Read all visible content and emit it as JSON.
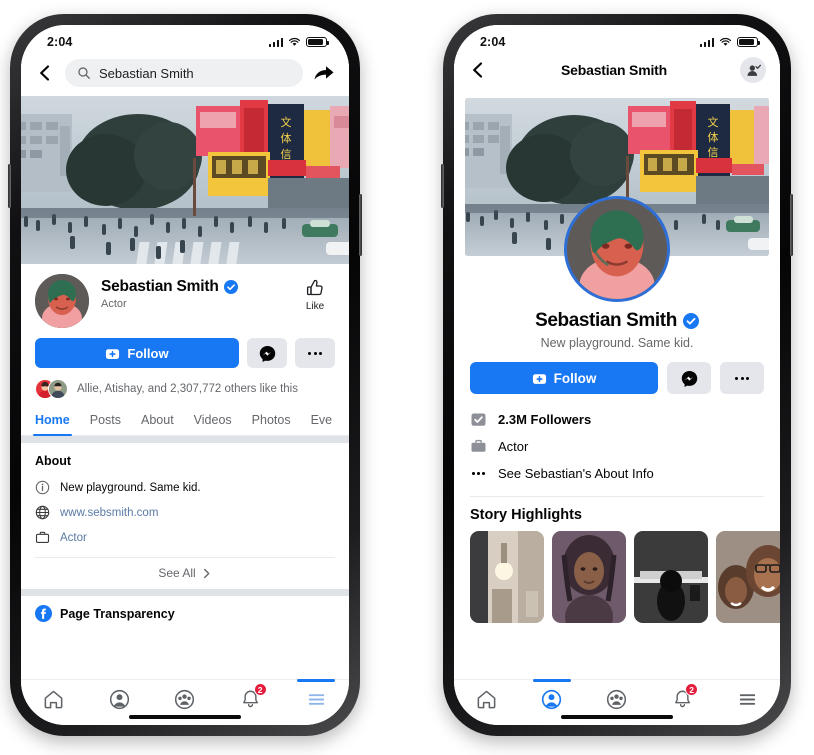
{
  "status_bar": {
    "time": "2:04",
    "signal_icon": "cellular-bars-icon",
    "wifi_icon": "wifi-icon",
    "battery_icon": "battery-icon"
  },
  "colors": {
    "brand_blue": "#1877f2",
    "verified_blue": "#1877f2",
    "badge_red": "#e41e3f",
    "chip_gray": "#e4e6eb",
    "text_secondary": "#65676b"
  },
  "left_phone": {
    "header": {
      "back_icon": "chevron-left-icon",
      "search_icon": "search-icon",
      "search_value": "Sebastian Smith",
      "search_placeholder": "Search",
      "share_icon": "share-arrow-icon"
    },
    "cover_photo_alt": "Shibuya crossing city street cover photo",
    "profile": {
      "avatar_alt": "Sebastian Smith profile photo",
      "name": "Sebastian Smith",
      "verified_icon": "verified-badge-icon",
      "category": "Actor",
      "like_icon": "thumbs-up-outline-icon",
      "like_label": "Like"
    },
    "actions": {
      "follow_label": "Follow",
      "follow_icon": "follow-plus-icon",
      "message_icon": "messenger-icon",
      "more_icon": "more-dots-icon"
    },
    "social_proof": "Allie, Atishay, and 2,307,772 others like this",
    "tabs": [
      {
        "label": "Home",
        "active": true
      },
      {
        "label": "Posts",
        "active": false
      },
      {
        "label": "About",
        "active": false
      },
      {
        "label": "Videos",
        "active": false
      },
      {
        "label": "Photos",
        "active": false
      },
      {
        "label": "Eve",
        "active": false
      }
    ],
    "about_card": {
      "title": "About",
      "rows": [
        {
          "icon": "info-circle-icon",
          "text": "New playground. Same kid.",
          "style": "plain"
        },
        {
          "icon": "globe-icon",
          "text": "www.sebsmith.com",
          "style": "link"
        },
        {
          "icon": "briefcase-icon",
          "text": "Actor",
          "style": "link"
        }
      ],
      "see_all_label": "See All",
      "see_all_icon": "chevron-right-icon"
    },
    "page_transparency": {
      "icon": "facebook-logo-icon",
      "label": "Page Transparency"
    },
    "bottom_nav": [
      {
        "icon": "home-icon",
        "active": false,
        "badge": ""
      },
      {
        "icon": "profile-circle-icon",
        "active": false,
        "badge": ""
      },
      {
        "icon": "groups-icon",
        "active": false,
        "badge": ""
      },
      {
        "icon": "notifications-bell-icon",
        "active": false,
        "badge": "2"
      },
      {
        "icon": "hamburger-menu-icon",
        "active": true,
        "badge": ""
      }
    ]
  },
  "right_phone": {
    "header": {
      "back_icon": "chevron-left-icon",
      "title": "Sebastian Smith",
      "add_friend_icon": "add-friend-icon"
    },
    "cover_photo_alt": "Shibuya crossing city street cover photo",
    "profile": {
      "avatar_alt": "Sebastian Smith profile photo",
      "name": "Sebastian Smith",
      "verified_icon": "verified-badge-icon",
      "bio": "New playground. Same kid."
    },
    "actions": {
      "follow_label": "Follow",
      "follow_icon": "follow-plus-icon",
      "message_icon": "messenger-icon",
      "more_icon": "more-dots-icon"
    },
    "info_rows": [
      {
        "icon": "followers-check-icon",
        "text": "2.3M Followers",
        "bold": true
      },
      {
        "icon": "briefcase-icon",
        "text": "Actor",
        "bold": false
      },
      {
        "icon": "more-dots-icon",
        "text": "See Sebastian's About Info",
        "bold": false
      }
    ],
    "story_highlights": {
      "title": "Story Highlights",
      "items": [
        {
          "alt": "Room interior with lamp story"
        },
        {
          "alt": "Portrait of woman with braids story"
        },
        {
          "alt": "Black and white silhouette story"
        },
        {
          "alt": "Two friends smiling selfie story"
        }
      ]
    },
    "bottom_nav": [
      {
        "icon": "home-icon",
        "active": false,
        "badge": ""
      },
      {
        "icon": "profile-circle-icon",
        "active": true,
        "badge": ""
      },
      {
        "icon": "groups-icon",
        "active": false,
        "badge": ""
      },
      {
        "icon": "notifications-bell-icon",
        "active": false,
        "badge": "2"
      },
      {
        "icon": "hamburger-menu-icon",
        "active": false,
        "badge": ""
      }
    ]
  }
}
